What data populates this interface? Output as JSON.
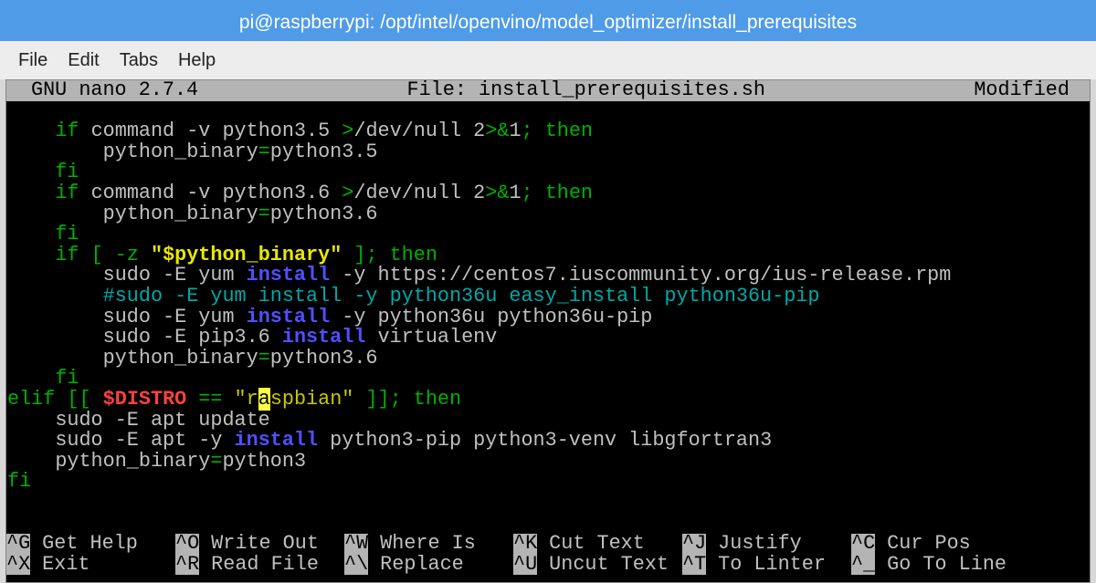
{
  "window": {
    "title": "pi@raspberrypi: /opt/intel/openvino/model_optimizer/install_prerequisites"
  },
  "menu": [
    "File",
    "Edit",
    "Tabs",
    "Help"
  ],
  "nano": {
    "version": "GNU nano 2.7.4",
    "file": "File: install_prerequisites.sh",
    "status": "Modified"
  },
  "lines": [
    [],
    [
      [
        "    ",
        "w"
      ],
      [
        "if",
        "g"
      ],
      [
        " command -v python3.5 ",
        "w"
      ],
      [
        ">",
        "g"
      ],
      [
        "/dev/null 2",
        "w"
      ],
      [
        ">&",
        "g"
      ],
      [
        "1",
        "w"
      ],
      [
        "; then",
        "g"
      ]
    ],
    [
      [
        "        python_binary",
        "w"
      ],
      [
        "=",
        "g"
      ],
      [
        "python3.5",
        "w"
      ]
    ],
    [
      [
        "    ",
        "w"
      ],
      [
        "fi",
        "g"
      ]
    ],
    [
      [
        "    ",
        "w"
      ],
      [
        "if",
        "g"
      ],
      [
        " command -v python3.6 ",
        "w"
      ],
      [
        ">",
        "g"
      ],
      [
        "/dev/null 2",
        "w"
      ],
      [
        ">&",
        "g"
      ],
      [
        "1",
        "w"
      ],
      [
        "; then",
        "g"
      ]
    ],
    [
      [
        "        python_binary",
        "w"
      ],
      [
        "=",
        "g"
      ],
      [
        "python3.6",
        "w"
      ]
    ],
    [
      [
        "    ",
        "w"
      ],
      [
        "fi",
        "g"
      ]
    ],
    [
      [
        "    ",
        "w"
      ],
      [
        "if [ -z ",
        "g"
      ],
      [
        "\"$python_binary\"",
        "y"
      ],
      [
        " ]; then",
        "g"
      ]
    ],
    [
      [
        "        sudo -E yum ",
        "w"
      ],
      [
        "install",
        "b"
      ],
      [
        " -y https://centos7.iuscommunity.org/ius-release.rpm",
        "w"
      ]
    ],
    [
      [
        "        #sudo -E yum install -y python36u easy_install python36u-pip",
        "c"
      ]
    ],
    [
      [
        "        sudo -E yum ",
        "w"
      ],
      [
        "install",
        "b"
      ],
      [
        " -y python36u python36u-pip",
        "w"
      ]
    ],
    [
      [
        "        sudo -E pip3.6 ",
        "w"
      ],
      [
        "install",
        "b"
      ],
      [
        " virtualenv",
        "w"
      ]
    ],
    [
      [
        "        python_binary",
        "w"
      ],
      [
        "=",
        "g"
      ],
      [
        "python3.6",
        "w"
      ]
    ],
    [
      [
        "    ",
        "w"
      ],
      [
        "fi",
        "g"
      ]
    ],
    [
      [
        "elif [[ ",
        "g"
      ],
      [
        "$DISTRO",
        "r"
      ],
      [
        " == ",
        "g"
      ],
      [
        "\"r",
        "s"
      ],
      [
        "a",
        "cur"
      ],
      [
        "spbian\"",
        "s"
      ],
      [
        " ]]; then",
        "g"
      ]
    ],
    [
      [
        "    sudo -E apt update",
        "w"
      ]
    ],
    [
      [
        "    sudo -E apt -y ",
        "w"
      ],
      [
        "install",
        "b"
      ],
      [
        " python3-pip python3-venv libgfortran3",
        "w"
      ]
    ],
    [
      [
        "    python_binary",
        "w"
      ],
      [
        "=",
        "g"
      ],
      [
        "python3",
        "w"
      ]
    ],
    [
      [
        "fi",
        "g"
      ]
    ],
    [],
    []
  ],
  "shortcuts": [
    [
      {
        "key": "^G",
        "label": "Get Help"
      },
      {
        "key": "^O",
        "label": "Write Out"
      },
      {
        "key": "^W",
        "label": "Where Is"
      },
      {
        "key": "^K",
        "label": "Cut Text"
      },
      {
        "key": "^J",
        "label": "Justify"
      },
      {
        "key": "^C",
        "label": "Cur Pos"
      }
    ],
    [
      {
        "key": "^X",
        "label": "Exit"
      },
      {
        "key": "^R",
        "label": "Read File"
      },
      {
        "key": "^\\",
        "label": "Replace"
      },
      {
        "key": "^U",
        "label": "Uncut Text"
      },
      {
        "key": "^T",
        "label": "To Linter"
      },
      {
        "key": "^_",
        "label": "Go To Line"
      }
    ]
  ]
}
